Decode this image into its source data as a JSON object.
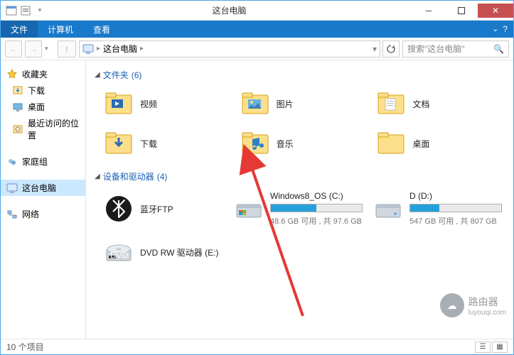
{
  "window": {
    "title": "这台电脑"
  },
  "menu": {
    "file": "文件",
    "computer": "计算机",
    "view": "查看"
  },
  "address": {
    "root": "这台电脑"
  },
  "search": {
    "placeholder": "搜索\"这台电脑\""
  },
  "sidebar": {
    "favorites": {
      "label": "收藏夹",
      "items": [
        {
          "label": "下载"
        },
        {
          "label": "桌面"
        },
        {
          "label": "最近访问的位置"
        }
      ]
    },
    "homegroup": {
      "label": "家庭组"
    },
    "thispc": {
      "label": "这台电脑"
    },
    "network": {
      "label": "网络"
    }
  },
  "sections": {
    "folders": {
      "title": "文件夹",
      "count": "(6)",
      "items": [
        {
          "name": "视频"
        },
        {
          "name": "图片"
        },
        {
          "name": "文档"
        },
        {
          "name": "下载"
        },
        {
          "name": "音乐"
        },
        {
          "name": "桌面"
        }
      ]
    },
    "drives": {
      "title": "设备和驱动器",
      "count": "(4)",
      "items": [
        {
          "name": "蓝牙FTP",
          "type": "bt"
        },
        {
          "name": "Windows8_OS (C:)",
          "type": "drive",
          "free": "48.6 GB 可用 , 共 97.6 GB",
          "pct": 50
        },
        {
          "name": "D (D:)",
          "type": "drive",
          "free": "547 GB 可用 , 共 807 GB",
          "pct": 32
        },
        {
          "name": "DVD RW 驱动器 (E:)",
          "type": "dvd"
        }
      ]
    }
  },
  "status": {
    "count": "10 个项目"
  },
  "watermark": {
    "text": "路由器",
    "sub": "luyouqi.com"
  }
}
